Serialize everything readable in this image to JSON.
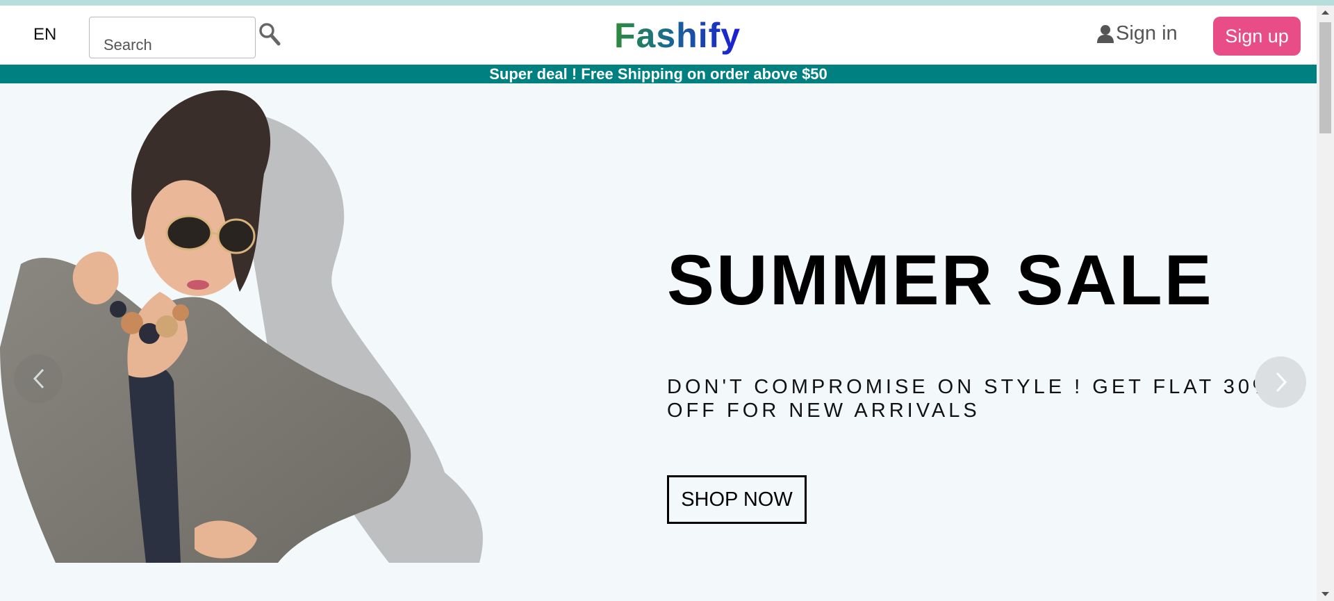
{
  "header": {
    "language": "EN",
    "search_placeholder": "Search",
    "logo": "Fashify",
    "signin_label": "Sign in",
    "signup_label": "Sign up"
  },
  "promo": {
    "text": "Super deal ! Free Shipping on order above $50"
  },
  "hero": {
    "title": "SUMMER SALE",
    "subtitle": "DON'T COMPROMISE ON STYLE ! GET FLAT 30% OFF FOR NEW ARRIVALS",
    "cta_label": "SHOP NOW"
  },
  "icons": {
    "search": "search-icon",
    "user": "user-icon",
    "prev": "chevron-left-icon",
    "next": "chevron-right-icon"
  },
  "colors": {
    "accent_teal": "#008080",
    "signup_pink": "#e84d88",
    "hero_bg": "#f3f8fa"
  }
}
